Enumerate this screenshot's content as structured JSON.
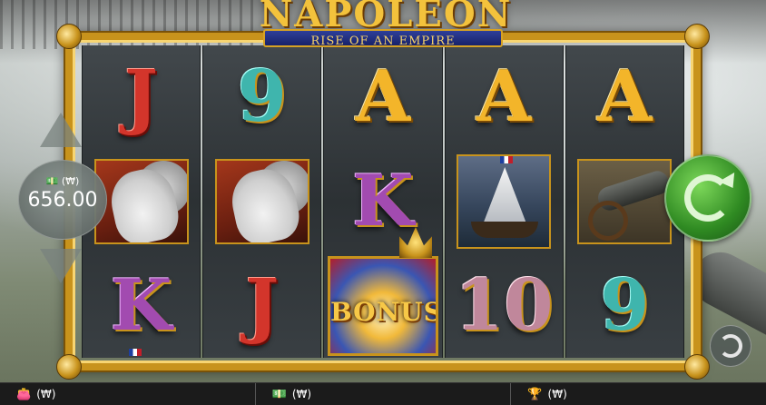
{
  "game": {
    "title": "NAPOLEON",
    "subtitle": "RISE OF AN EMPIRE"
  },
  "reels": [
    [
      "J",
      "horse",
      "K"
    ],
    [
      "9",
      "horse",
      "J"
    ],
    [
      "A",
      "K",
      "bonus"
    ],
    [
      "A",
      "ship",
      "10"
    ],
    [
      "A",
      "cannon",
      "9"
    ]
  ],
  "bonus_label": "BONUS",
  "stake": {
    "currency_icon": "₩",
    "value": "656.00"
  },
  "bottom_bar": {
    "balance": "(₩)",
    "bet": "(₩)",
    "win": "(₩)"
  },
  "icons": {
    "balance": "wallet-icon",
    "bet": "banknote-icon",
    "win": "trophy-icon",
    "spin": "spin-icon",
    "autoplay": "autoplay-icon"
  },
  "colors": {
    "frame_gold": "#c8931c",
    "spin_green": "#2f8a22",
    "bottom_bar": "#1b1b1b"
  }
}
